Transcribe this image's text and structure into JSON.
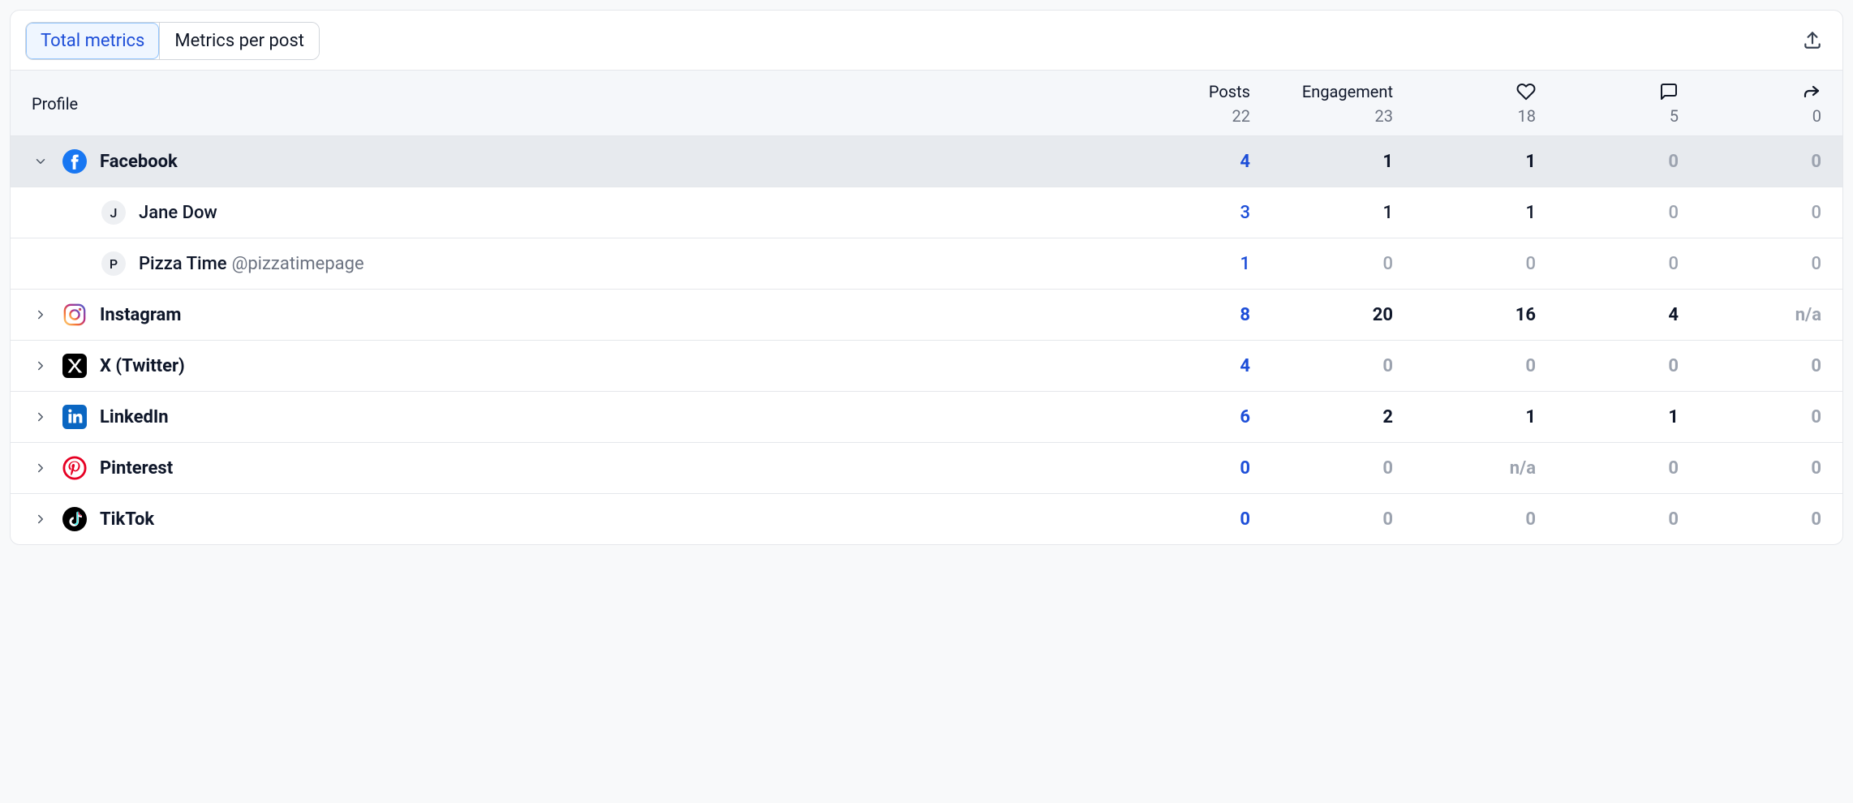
{
  "tabs": {
    "total": "Total metrics",
    "per_post": "Metrics per post"
  },
  "header": {
    "profile": "Profile",
    "posts": "Posts",
    "engagement": "Engagement",
    "totals": {
      "posts": "22",
      "engagement": "23",
      "likes": "18",
      "comments": "5",
      "shares": "0"
    }
  },
  "platforms": [
    {
      "id": "facebook",
      "name": "Facebook",
      "expanded": true,
      "posts": "4",
      "engagement": "1",
      "likes": "1",
      "comments": "0",
      "shares": "0",
      "eng_muted": false,
      "likes_muted": false,
      "comments_muted": true,
      "shares_muted": true,
      "children": [
        {
          "initial": "J",
          "name": "Jane Dow",
          "handle": "",
          "posts": "3",
          "engagement": "1",
          "likes": "1",
          "comments": "0",
          "shares": "0",
          "eng_muted": false,
          "likes_muted": false,
          "comments_muted": true,
          "shares_muted": true
        },
        {
          "initial": "P",
          "name": "Pizza Time",
          "handle": "@pizzatimepage",
          "posts": "1",
          "engagement": "0",
          "likes": "0",
          "comments": "0",
          "shares": "0",
          "eng_muted": true,
          "likes_muted": true,
          "comments_muted": true,
          "shares_muted": true
        }
      ]
    },
    {
      "id": "instagram",
      "name": "Instagram",
      "expanded": false,
      "posts": "8",
      "engagement": "20",
      "likes": "16",
      "comments": "4",
      "shares": "n/a",
      "eng_muted": false,
      "likes_muted": false,
      "comments_muted": false,
      "shares_muted": true
    },
    {
      "id": "twitter",
      "name": "X (Twitter)",
      "expanded": false,
      "posts": "4",
      "engagement": "0",
      "likes": "0",
      "comments": "0",
      "shares": "0",
      "eng_muted": true,
      "likes_muted": true,
      "comments_muted": true,
      "shares_muted": true
    },
    {
      "id": "linkedin",
      "name": "LinkedIn",
      "expanded": false,
      "posts": "6",
      "engagement": "2",
      "likes": "1",
      "comments": "1",
      "shares": "0",
      "eng_muted": false,
      "likes_muted": false,
      "comments_muted": false,
      "shares_muted": true
    },
    {
      "id": "pinterest",
      "name": "Pinterest",
      "expanded": false,
      "posts": "0",
      "engagement": "0",
      "likes": "n/a",
      "comments": "0",
      "shares": "0",
      "eng_muted": true,
      "likes_muted": true,
      "comments_muted": true,
      "shares_muted": true
    },
    {
      "id": "tiktok",
      "name": "TikTok",
      "expanded": false,
      "posts": "0",
      "engagement": "0",
      "likes": "0",
      "comments": "0",
      "shares": "0",
      "eng_muted": true,
      "likes_muted": true,
      "comments_muted": true,
      "shares_muted": true
    }
  ],
  "chart_data": {
    "type": "table",
    "columns": [
      "Profile",
      "Posts",
      "Engagement",
      "Likes",
      "Comments",
      "Shares"
    ],
    "totals": {
      "Posts": 22,
      "Engagement": 23,
      "Likes": 18,
      "Comments": 5,
      "Shares": 0
    },
    "rows": [
      {
        "Profile": "Facebook",
        "Posts": 4,
        "Engagement": 1,
        "Likes": 1,
        "Comments": 0,
        "Shares": 0
      },
      {
        "Profile": "Facebook / Jane Dow",
        "Posts": 3,
        "Engagement": 1,
        "Likes": 1,
        "Comments": 0,
        "Shares": 0
      },
      {
        "Profile": "Facebook / Pizza Time @pizzatimepage",
        "Posts": 1,
        "Engagement": 0,
        "Likes": 0,
        "Comments": 0,
        "Shares": 0
      },
      {
        "Profile": "Instagram",
        "Posts": 8,
        "Engagement": 20,
        "Likes": 16,
        "Comments": 4,
        "Shares": "n/a"
      },
      {
        "Profile": "X (Twitter)",
        "Posts": 4,
        "Engagement": 0,
        "Likes": 0,
        "Comments": 0,
        "Shares": 0
      },
      {
        "Profile": "LinkedIn",
        "Posts": 6,
        "Engagement": 2,
        "Likes": 1,
        "Comments": 1,
        "Shares": 0
      },
      {
        "Profile": "Pinterest",
        "Posts": 0,
        "Engagement": 0,
        "Likes": "n/a",
        "Comments": 0,
        "Shares": 0
      },
      {
        "Profile": "TikTok",
        "Posts": 0,
        "Engagement": 0,
        "Likes": 0,
        "Comments": 0,
        "Shares": 0
      }
    ]
  }
}
